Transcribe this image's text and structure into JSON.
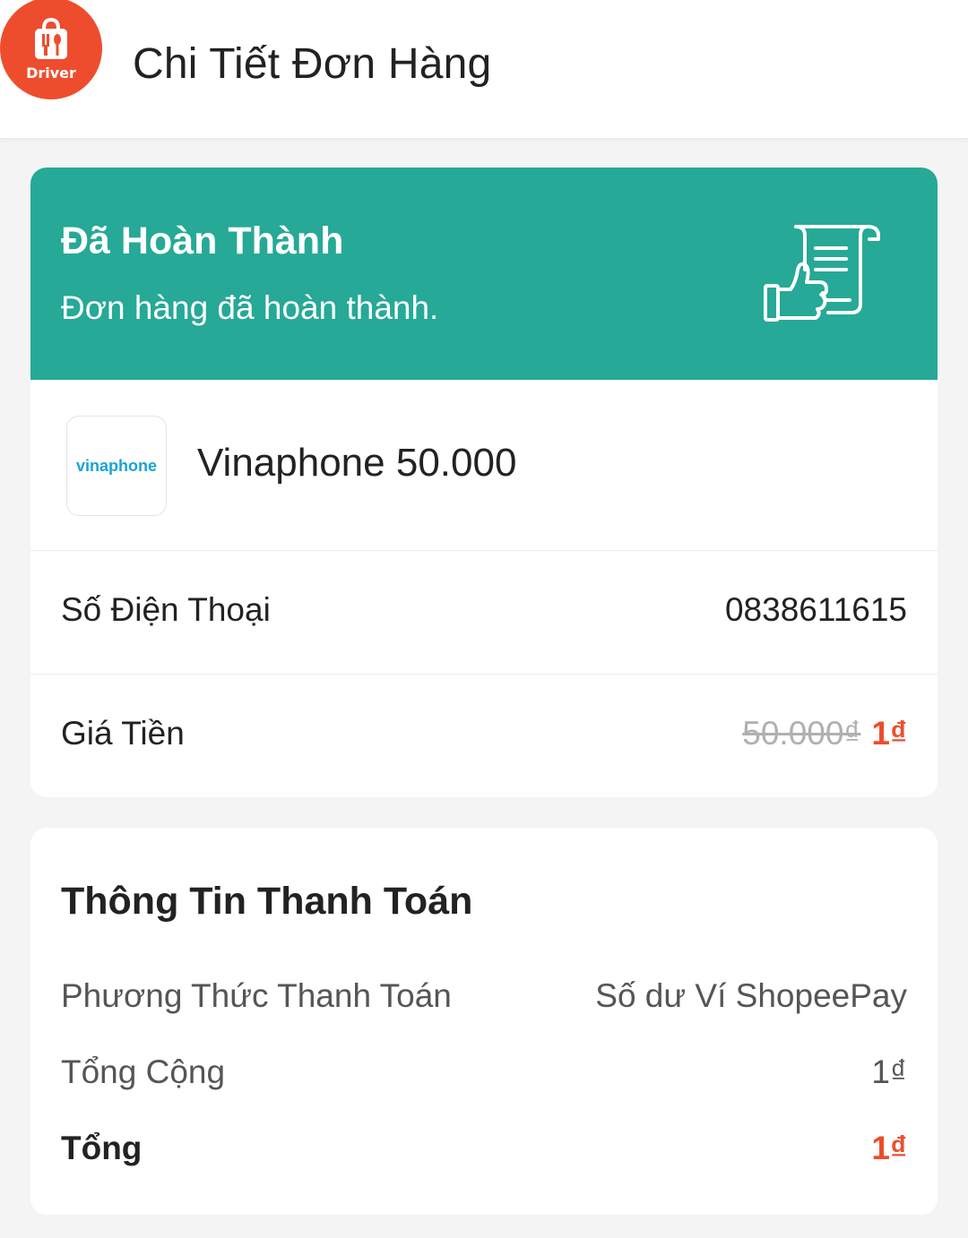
{
  "header": {
    "app_icon_label": "Driver",
    "title": "Chi Tiết Đơn Hàng"
  },
  "status": {
    "title": "Đã Hoàn Thành",
    "subtitle": "Đơn hàng đã hoàn thành.",
    "icon": "receipt-thumbs-up-icon"
  },
  "product": {
    "logo_text": "vinaphone",
    "name": "Vinaphone 50.000"
  },
  "order_info": {
    "phone_label": "Số Điện Thoại",
    "phone_value": "0838611615",
    "price_label": "Giá Tiền",
    "price_original": "50.000₫",
    "price_final": "1₫"
  },
  "payment": {
    "title": "Thông Tin Thanh Toán",
    "method_label": "Phương Thức Thanh Toán",
    "method_value": "Số dư Ví ShopeePay",
    "subtotal_label": "Tổng Cộng",
    "subtotal_value": "1₫",
    "total_label": "Tổng",
    "total_value": "1₫"
  },
  "colors": {
    "brand_orange": "#ee4d2d",
    "status_green": "#26a996",
    "background": "#f4f4f4"
  }
}
